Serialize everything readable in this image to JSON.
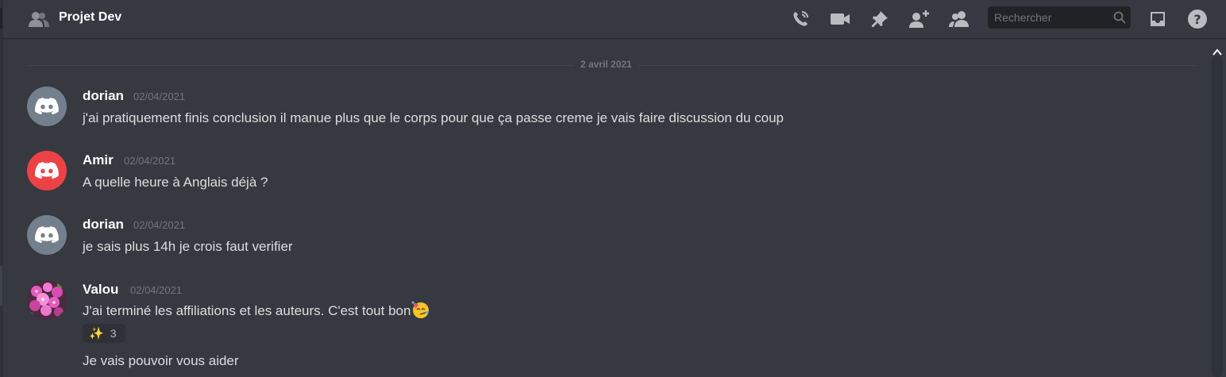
{
  "header": {
    "channel_name": "Projet Dev",
    "search_placeholder": "Rechercher",
    "toolbar_icons": [
      "call-icon",
      "video-icon",
      "pin-icon",
      "add-member-icon",
      "members-icon",
      "search-icon",
      "inbox-icon",
      "help-icon"
    ]
  },
  "divider": {
    "date": "2 avril 2021"
  },
  "messages": [
    {
      "author": "dorian",
      "timestamp": "02/04/2021",
      "text": "j'ai pratiquement finis conclusion il manue plus que le corps pour que ça passe creme je vais faire discussion du coup",
      "avatar_color": "#747f8d"
    },
    {
      "author": "Amir",
      "timestamp": "02/04/2021",
      "text": "A quelle heure à Anglais déjà ?",
      "avatar_color": "#ed4245"
    },
    {
      "author": "dorian",
      "timestamp": "02/04/2021",
      "text": "je sais plus 14h je crois faut verifier",
      "avatar_color": "#747f8d"
    },
    {
      "author": "Valou",
      "timestamp": "02/04/2021",
      "text": "J'ai terminé les affiliations et les auteurs. C'est tout bon",
      "avatar_color": "#c04a9a",
      "reaction": {
        "emoji": "✨",
        "count": "3"
      },
      "followup": "Je vais pouvoir vous aider"
    }
  ],
  "colors": {
    "background": "#36393f",
    "text": "#dcddde",
    "muted": "#72767d",
    "username": "#ffffff"
  }
}
